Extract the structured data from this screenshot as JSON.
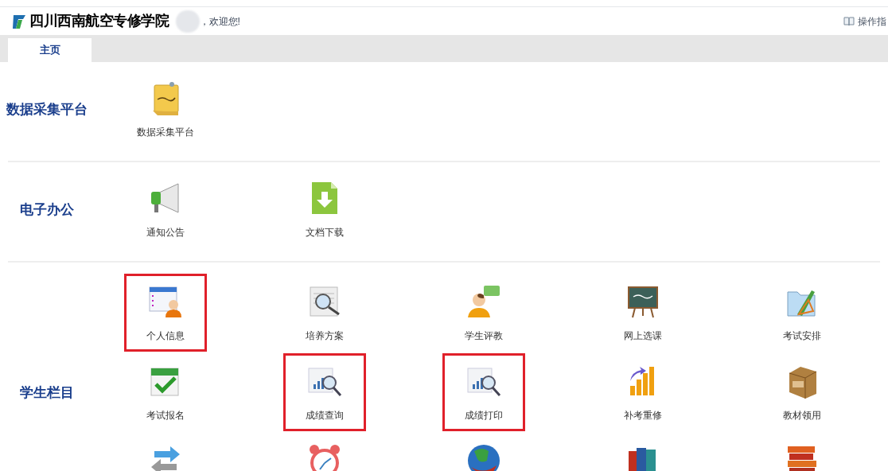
{
  "header": {
    "school_name": "四川西南航空专修学院",
    "welcome": "，欢迎您!",
    "guide_link": "操作指"
  },
  "tabs": [
    {
      "label": "主页",
      "selected": true
    }
  ],
  "sections": [
    {
      "title": "数据采集平台",
      "items": [
        {
          "label": "数据采集平台",
          "highlighted": false
        }
      ]
    },
    {
      "title": "电子办公",
      "items": [
        {
          "label": "通知公告",
          "highlighted": false
        },
        {
          "label": "文档下载",
          "highlighted": false
        }
      ]
    },
    {
      "title": "学生栏目",
      "items": [
        {
          "label": "个人信息",
          "highlighted": true
        },
        {
          "label": "培养方案",
          "highlighted": false
        },
        {
          "label": "学生评教",
          "highlighted": false
        },
        {
          "label": "网上选课",
          "highlighted": false
        },
        {
          "label": "考试安排",
          "highlighted": false
        },
        {
          "label": "考试报名",
          "highlighted": false
        },
        {
          "label": "成绩查询",
          "highlighted": true
        },
        {
          "label": "成绩打印",
          "highlighted": true
        },
        {
          "label": "补考重修",
          "highlighted": false
        },
        {
          "label": "教材领用",
          "highlighted": false
        },
        {
          "highlighted": false
        },
        {
          "highlighted": false
        },
        {
          "highlighted": false
        },
        {
          "highlighted": false
        },
        {
          "highlighted": false
        }
      ]
    }
  ]
}
